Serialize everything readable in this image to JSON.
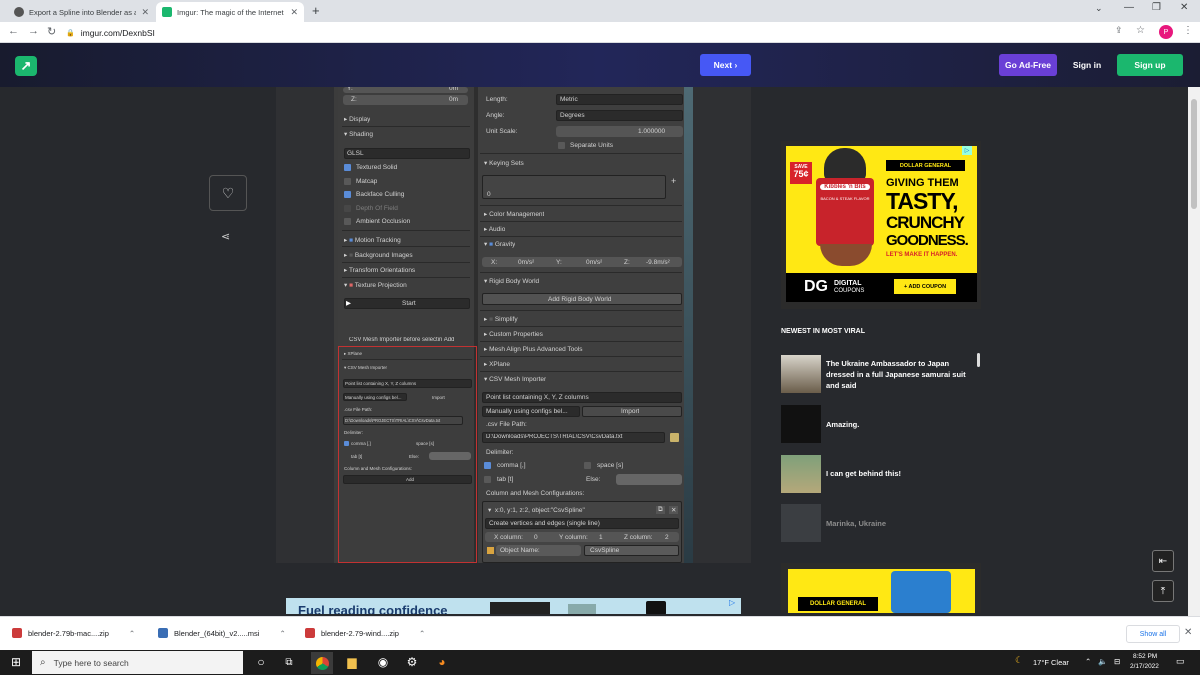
{
  "browser": {
    "tabs": [
      {
        "title": "Export a Spline into Blender as a",
        "active": false
      },
      {
        "title": "Imgur: The magic of the Internet",
        "active": true
      }
    ],
    "url": "imgur.com/DexnbSI",
    "profile_initial": "P"
  },
  "imgur_header": {
    "next_label": "Next",
    "ad_free_label": "Go Ad-Free",
    "sign_in_label": "Sign in",
    "sign_up_label": "Sign up"
  },
  "blender": {
    "left": {
      "y_row": "Y:",
      "y_val": "0m",
      "z_row": "Z:",
      "z_val": "0m",
      "display": "Display",
      "shading": "Shading",
      "glsl": "GLSL",
      "textured_solid": "Textured Solid",
      "matcap": "Matcap",
      "backface": "Backface Culling",
      "dof": "Depth Of Field",
      "ao": "Ambient Occlusion",
      "motion": "Motion Tracking",
      "bgimages": "Background Images",
      "transform": "Transform Orientations",
      "texproj": "Texture Projection",
      "start": "Start",
      "csv_caption": "CSV Mesh Importer before selectin Add",
      "xplane": "XPlane",
      "csv_importer": "CSV Mesh Importer",
      "points": "Point list containing X, Y, Z columns",
      "manual": "Manually using configs bel...",
      "import": "Import",
      "csvpath_label": ".csv File Path:",
      "csvpath": "D:\\Downloads\\PROJECTS\\TRIAL\\CSV\\CsvData.txt",
      "delimiter": "Delimiter:",
      "comma": "comma [,]",
      "space": "space [s]",
      "tab": "tab [t]",
      "else": "Else:",
      "colconf": "Column and Mesh Configurations:",
      "add": "Add"
    },
    "right": {
      "length": "Length:",
      "length_val": "Metric",
      "angle": "Angle:",
      "angle_val": "Degrees",
      "unit_scale": "Unit Scale:",
      "unit_scale_val": "1.000000",
      "separate": "Separate Units",
      "keying": "Keying Sets",
      "zero": "0",
      "color_mgmt": "Color Management",
      "audio": "Audio",
      "gravity": "Gravity",
      "gx": "X:",
      "gx_val": "0m/s²",
      "gy": "Y:",
      "gy_val": "0m/s²",
      "gz": "Z:",
      "gz_val": "-9.8m/s²",
      "rigid": "Rigid Body World",
      "add_rigid": "Add Rigid Body World",
      "simplify": "Simplify",
      "custom_props": "Custom Properties",
      "mesh_align": "Mesh Align Plus Advanced Tools",
      "xplane": "XPlane",
      "csv_importer": "CSV Mesh Importer",
      "points": "Point list containing X, Y, Z columns",
      "manual": "Manually using configs bel...",
      "import": "Import",
      "csvpath_label": ".csv File Path:",
      "csvpath": "D:\\Downloads\\PROJECTS\\TRIAL\\CSV\\CsvData.txt",
      "delimiter": "Delimiter:",
      "comma": "comma [,]",
      "space": "space [s]",
      "tab": "tab [t]",
      "else": "Else:",
      "colconf": "Column and Mesh Configurations:",
      "config": "x:0, y:1, z:2, object:\"CsvSpline\"",
      "create": "Create vertices and edges (single line)",
      "xcol": "X column:",
      "xcol_val": "0",
      "ycol": "Y column:",
      "ycol_val": "1",
      "zcol": "Z column:",
      "zcol_val": "2",
      "objname": "Object Name:",
      "objname_val": "CsvSpline"
    }
  },
  "ad_kibbles": {
    "save": "SAVE",
    "save_amt": "75¢",
    "brand": "Kibbles 'n Bits",
    "flavor": "BACON & STEAK FLAVOR",
    "store": "DOLLAR GENERAL",
    "headline1": "GIVING THEM",
    "headline2": "TASTY,",
    "headline3": "CRUNCHY",
    "headline4": "GOODNESS.",
    "tagline": "LET'S MAKE IT HAPPEN.",
    "dg": "DG",
    "digital": "DIGITAL",
    "coupons": "COUPONS",
    "add_coupon": "+ ADD COUPON"
  },
  "viral": {
    "heading": "NEWEST IN MOST VIRAL",
    "items": [
      {
        "title": "The Ukraine Ambassador to Japan dressed in a full Japanese samurai suit and said"
      },
      {
        "title": "Amazing."
      },
      {
        "title": "I can get behind this!"
      },
      {
        "title": "Marinka, Ukraine"
      }
    ]
  },
  "ad_bottom": {
    "store": "DOLLAR GENERAL",
    "banner": "Fuel reading confidence"
  },
  "downloads": {
    "items": [
      {
        "name": "blender-2.79b-mac....zip"
      },
      {
        "name": "Blender_(64bit)_v2.....msi"
      },
      {
        "name": "blender-2.79-wind....zip"
      }
    ],
    "show_all": "Show all"
  },
  "taskbar": {
    "search_placeholder": "Type here to search",
    "weather": "17°F  Clear",
    "time": "8:52 PM",
    "date": "2/17/2022"
  }
}
